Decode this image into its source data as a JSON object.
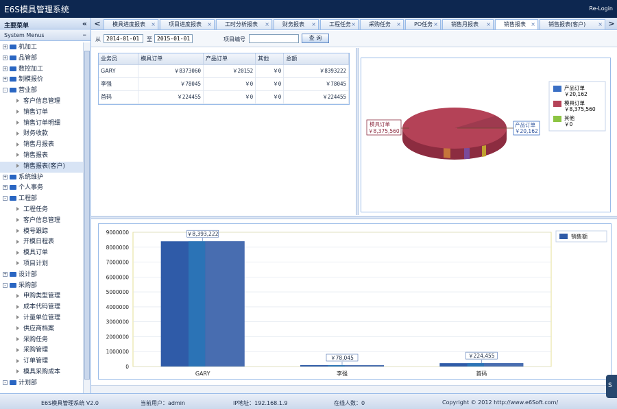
{
  "app": {
    "title": "E6S模具管理系统",
    "relogin": "Re-Login"
  },
  "sidebar": {
    "header": "主要菜单",
    "collapse_icon": "«",
    "section": "System Menus",
    "tree": [
      {
        "label": "机加工",
        "level": 0,
        "expander": "+"
      },
      {
        "label": "品管部",
        "level": 0,
        "expander": "+"
      },
      {
        "label": "数控加工",
        "level": 0,
        "expander": "+"
      },
      {
        "label": "制模报价",
        "level": 0,
        "expander": "+"
      },
      {
        "label": "营业部",
        "level": 0,
        "expander": "-"
      },
      {
        "label": "客户信息管理",
        "level": 1
      },
      {
        "label": "销售订单",
        "level": 1
      },
      {
        "label": "销售订单明细",
        "level": 1
      },
      {
        "label": "财务收款",
        "level": 1
      },
      {
        "label": "销售月报表",
        "level": 1
      },
      {
        "label": "销售报表",
        "level": 1
      },
      {
        "label": "销售报表(客户)",
        "level": 1,
        "selected": true
      },
      {
        "label": "系统维护",
        "level": 0,
        "expander": "+"
      },
      {
        "label": "个人事务",
        "level": 0,
        "expander": "+"
      },
      {
        "label": "工程部",
        "level": 0,
        "expander": "-"
      },
      {
        "label": "工程任务",
        "level": 1
      },
      {
        "label": "客户信息管理",
        "level": 1
      },
      {
        "label": "模号跟踪",
        "level": 1
      },
      {
        "label": "开模日程表",
        "level": 1
      },
      {
        "label": "模具订单",
        "level": 1
      },
      {
        "label": "项目计划",
        "level": 1
      },
      {
        "label": "设计部",
        "level": 0,
        "expander": "+"
      },
      {
        "label": "采购部",
        "level": 0,
        "expander": "-"
      },
      {
        "label": "申购类型管理",
        "level": 1
      },
      {
        "label": "成本代码管理",
        "level": 1
      },
      {
        "label": "计量单位管理",
        "level": 1
      },
      {
        "label": "供应商档案",
        "level": 1
      },
      {
        "label": "采购任务",
        "level": 1
      },
      {
        "label": "采购管理",
        "level": 1
      },
      {
        "label": "订单管理",
        "level": 1
      },
      {
        "label": "模具采购成本",
        "level": 1
      },
      {
        "label": "计划部",
        "level": 0,
        "expander": "-"
      }
    ]
  },
  "tabs": {
    "prev": "<",
    "next": ">",
    "items": [
      {
        "label": "模具进度报表",
        "close": "×"
      },
      {
        "label": "项目进度报表",
        "close": "×"
      },
      {
        "label": "工时分析报表",
        "close": "×"
      },
      {
        "label": "财务报表",
        "close": "×"
      },
      {
        "label": "工程任务",
        "close": "×"
      },
      {
        "label": "采购任务",
        "close": "×"
      },
      {
        "label": "PO任务",
        "close": "×"
      },
      {
        "label": "销售月报表",
        "close": "×"
      },
      {
        "label": "销售报表",
        "close": "×",
        "active": true
      },
      {
        "label": "销售报表(客户)",
        "close": "×"
      }
    ]
  },
  "filter": {
    "from_label": "从",
    "from_date": "2014-01-01",
    "to_label": "至",
    "to_date": "2015-01-01",
    "project_label": "项目编号",
    "project_value": "",
    "query_button": "查 询"
  },
  "grid": {
    "columns": [
      "业务员",
      "模具订单",
      "产品订单",
      "其他",
      "总额"
    ],
    "rows": [
      [
        "GARY",
        "￥8373060",
        "￥20152",
        "￥0",
        "￥8393222"
      ],
      [
        "李强",
        "￥78045",
        "￥0",
        "￥0",
        "￥78045"
      ],
      [
        "首码",
        "￥224455",
        "￥0",
        "￥0",
        "￥224455"
      ]
    ]
  },
  "pie_chart": {
    "legend": [
      {
        "name": "产品订单",
        "value": "￥20,162",
        "color": "#3a6fc4"
      },
      {
        "name": "模具订单",
        "value": "￥8,375,560",
        "color": "#b44257"
      },
      {
        "name": "其他",
        "value": "￥0",
        "color": "#8cc442"
      }
    ],
    "callouts": [
      {
        "name": "模具订单",
        "value": "￥8,375,560"
      },
      {
        "name": "产品订单",
        "value": "￥20,162"
      }
    ]
  },
  "chart_data": {
    "type": "bar",
    "categories": [
      "GARY",
      "李强",
      "首码"
    ],
    "series": [
      {
        "name": "销售额",
        "values": [
          8393222,
          78045,
          224455
        ]
      }
    ],
    "data_labels": [
      "￥8,393,222",
      "￥78,045",
      "￥224,455"
    ],
    "yticks": [
      "0",
      "1000000",
      "2000000",
      "3000000",
      "4000000",
      "5000000",
      "6000000",
      "7000000",
      "8000000",
      "9000000"
    ],
    "ylim": [
      0,
      9000000
    ],
    "legend": "top-right",
    "bar_color": "#2f5ba8"
  },
  "status": {
    "system": "E6S模具管理系统 V2.0",
    "user": "当前用户：admin",
    "ip": "IP地址：192.168.1.9",
    "online": "在线人数：0",
    "copyright": "Copyright © 2012 http://www.e6Soft.com/"
  },
  "dock_icon": "S"
}
